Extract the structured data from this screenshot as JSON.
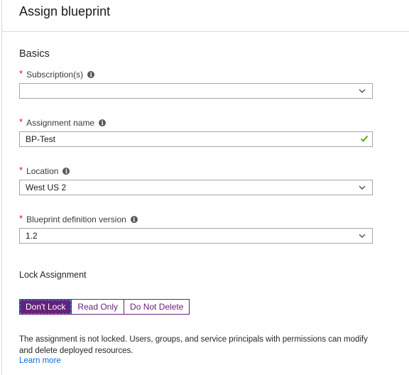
{
  "panel": {
    "title": "Assign blueprint"
  },
  "basics": {
    "section_title": "Basics",
    "fields": [
      {
        "label": "Subscription(s)",
        "required": "*",
        "value": "",
        "control": "dropdown",
        "icon": "chevron-down-icon"
      },
      {
        "label": "Assignment name",
        "required": "*",
        "value": "BP-Test",
        "control": "text",
        "icon": "checkmark-icon",
        "valid": true
      },
      {
        "label": "Location",
        "required": "*",
        "value": "West US 2",
        "control": "dropdown",
        "icon": "chevron-down-icon"
      },
      {
        "label": "Blueprint definition version",
        "required": "*",
        "value": "1.2",
        "control": "dropdown",
        "icon": "chevron-down-icon"
      }
    ],
    "info_icon_glyph": "i"
  },
  "lock": {
    "label": "Lock Assignment",
    "options": [
      "Don't Lock",
      "Read Only",
      "Do Not Delete"
    ],
    "selected": "Don't Lock",
    "description": "The assignment is not locked. Users, groups, and service principals with permissions can modify and delete deployed resources.",
    "learn_more": "Learn more"
  },
  "colors": {
    "accent": "#68217a",
    "required": "#e00b1c",
    "valid": "#57a300",
    "link": "#0a6fd6",
    "focus": "#1ea7e1"
  }
}
